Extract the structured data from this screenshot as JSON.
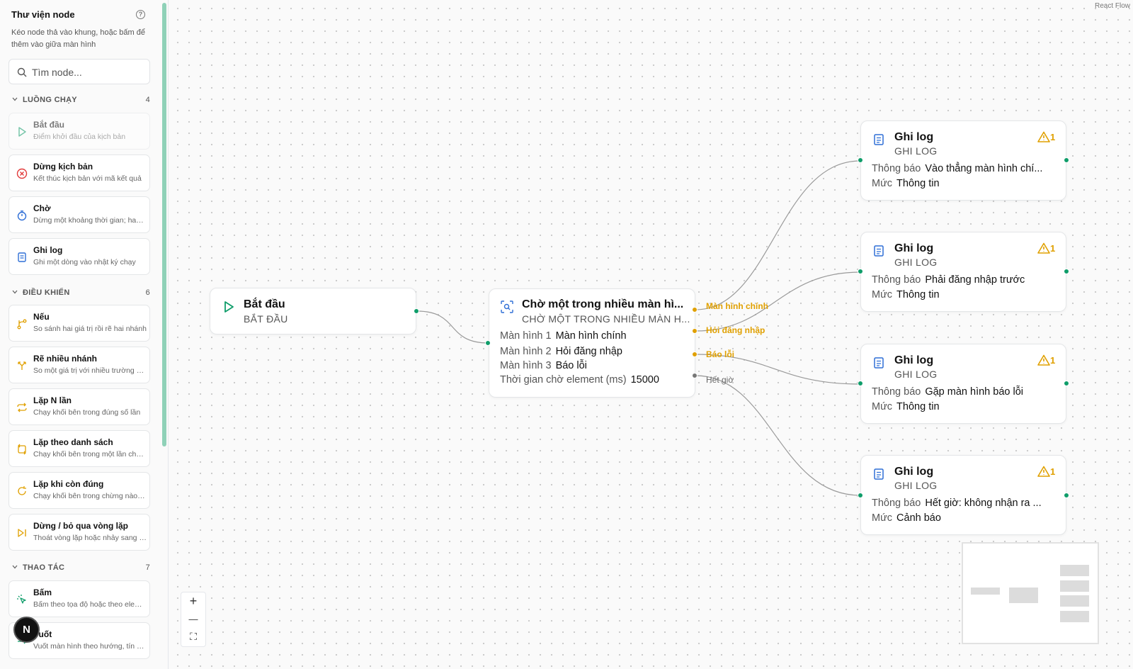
{
  "sidebar": {
    "title": "Thư viện node",
    "help_icon": "?",
    "description": "Kéo node thả vào khung, hoặc bấm để thêm vào giữa màn hình",
    "search_placeholder": "Tìm node...",
    "categories": [
      {
        "name": "LUỒNG CHẠY",
        "count": "4"
      },
      {
        "name": "ĐIỀU KHIỂN",
        "count": "6"
      },
      {
        "name": "THAO TÁC",
        "count": "7"
      }
    ],
    "items": [
      {
        "title": "Bắt đầu",
        "desc": "Điểm khởi đầu của kịch bản",
        "icon": "play-icon"
      },
      {
        "title": "Dừng kịch bản",
        "desc": "Kết thúc kịch bản với mã kết quả",
        "icon": "stop-circle-icon"
      },
      {
        "title": "Chờ",
        "desc": "Dừng một khoảng thời gian; hay chờ",
        "icon": "timer-icon"
      },
      {
        "title": "Ghi log",
        "desc": "Ghi một dòng vào nhật ký chạy",
        "icon": "log-scroll-icon"
      },
      {
        "title": "Nếu",
        "desc": "So sánh hai giá trị rồi rẽ hai nhánh",
        "icon": "branch-icon"
      },
      {
        "title": "Rẽ nhiều nhánh",
        "desc": "So một giá trị với nhiều trường hợp",
        "icon": "split-icon"
      },
      {
        "title": "Lặp N lần",
        "desc": "Chạy khối bên trong đúng số lần",
        "icon": "repeat-icon"
      },
      {
        "title": "Lặp theo danh sách",
        "desc": "Chạy khối bên trong một lần cho mỗi",
        "icon": "repeat-list-icon"
      },
      {
        "title": "Lặp khi còn đúng",
        "desc": "Chạy khối bên trong chừng nào còn đúng",
        "icon": "loop-icon"
      },
      {
        "title": "Dừng / bỏ qua vòng lặp",
        "desc": "Thoát vòng lặp hoặc nhảy sang lần sau",
        "icon": "skip-icon"
      },
      {
        "title": "Bấm",
        "desc": "Bấm theo tọa độ hoặc theo element",
        "icon": "tap-icon"
      },
      {
        "title": "Vuốt",
        "desc": "Vuốt màn hình theo hướng, tín hiệu",
        "icon": "swipe-icon"
      }
    ],
    "avatar_letter": "N"
  },
  "canvas": {
    "attribution": "React Flow",
    "controls": {
      "zoom_in": "+",
      "zoom_out": "—",
      "fit": "⛶"
    },
    "start_node": {
      "title": "Bắt đầu",
      "subtitle": "BẮT ĐẦU"
    },
    "wait_node": {
      "title": "Chờ một trong nhiều màn hì...",
      "subtitle": "CHỜ MỘT TRONG NHIỀU MÀN H...",
      "rows": [
        {
          "key": "Màn hình 1",
          "value": "Màn hình chính"
        },
        {
          "key": "Màn hình 2",
          "value": "Hỏi đăng nhập"
        },
        {
          "key": "Màn hình 3",
          "value": "Báo lỗi"
        },
        {
          "key": "Thời gian chờ element (ms)",
          "value": "15000"
        }
      ],
      "outputs": [
        "Màn hình chính",
        "Hỏi đăng nhập",
        "Báo lỗi",
        "Hết giờ"
      ]
    },
    "log_nodes": [
      {
        "title": "Ghi log",
        "subtitle": "GHI LOG",
        "warn": "1",
        "msg_key": "Thông báo",
        "msg": "Vào thẳng màn hình chí...",
        "level_key": "Mức",
        "level": "Thông tin"
      },
      {
        "title": "Ghi log",
        "subtitle": "GHI LOG",
        "warn": "1",
        "msg_key": "Thông báo",
        "msg": "Phải đăng nhập trước",
        "level_key": "Mức",
        "level": "Thông tin"
      },
      {
        "title": "Ghi log",
        "subtitle": "GHI LOG",
        "warn": "1",
        "msg_key": "Thông báo",
        "msg": "Gặp màn hình báo lỗi",
        "level_key": "Mức",
        "level": "Thông tin"
      },
      {
        "title": "Ghi log",
        "subtitle": "GHI LOG",
        "warn": "1",
        "msg_key": "Thông báo",
        "msg": "Hết giờ: không nhận ra ...",
        "level_key": "Mức",
        "level": "Cảnh báo"
      }
    ],
    "colors": {
      "accent": "#0f9d6a",
      "warning": "#e0a000",
      "edge": "#9a9a9a"
    }
  }
}
